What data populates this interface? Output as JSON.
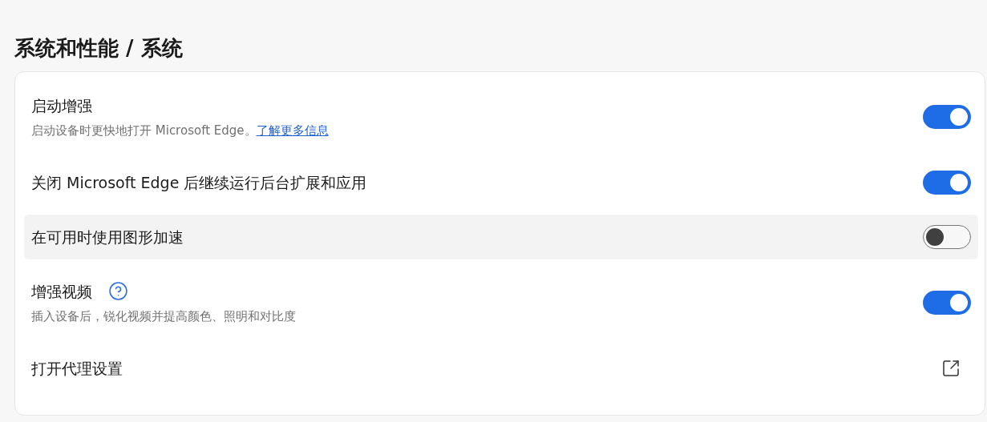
{
  "breadcrumb": "系统和性能 / 系统",
  "settings": [
    {
      "kind": "toggle",
      "title": "启动增强",
      "description": "启动设备时更快地打开 Microsoft Edge。",
      "link": "了解更多信息",
      "help": false,
      "on": true,
      "highlighted": false
    },
    {
      "kind": "toggle",
      "title": "关闭 Microsoft Edge 后继续运行后台扩展和应用",
      "help": false,
      "on": true,
      "highlighted": false
    },
    {
      "kind": "toggle",
      "title": "在可用时使用图形加速",
      "help": false,
      "on": false,
      "highlighted": true
    },
    {
      "kind": "toggle",
      "title": "增强视频",
      "description": "插入设备后，锐化视频并提高颜色、照明和对比度",
      "help": true,
      "on": true,
      "highlighted": false
    },
    {
      "kind": "external",
      "title": "打开代理设置",
      "help": false,
      "highlighted": false
    }
  ]
}
